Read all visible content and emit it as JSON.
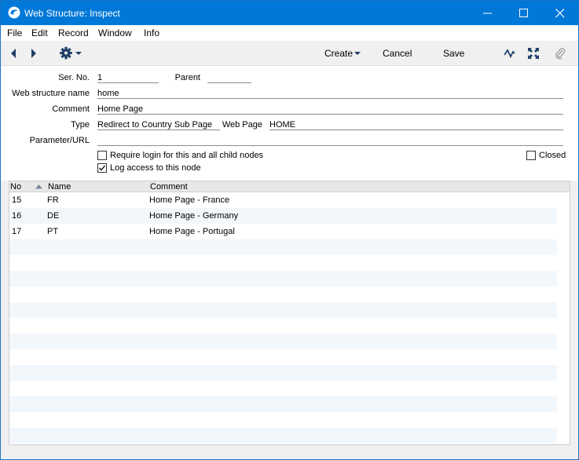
{
  "window": {
    "title": "Web Structure: Inspect"
  },
  "menu": {
    "items": [
      "File",
      "Edit",
      "Record",
      "Window",
      "Info"
    ]
  },
  "toolbar": {
    "create_label": "Create",
    "cancel_label": "Cancel",
    "save_label": "Save"
  },
  "form": {
    "ser_no_label": "Ser. No.",
    "ser_no_value": "1",
    "parent_label": "Parent",
    "parent_value": "",
    "name_label": "Web structure name",
    "name_value": "home",
    "comment_label": "Comment",
    "comment_value": "Home Page",
    "type_label": "Type",
    "type_value": "Redirect to Country Sub Page",
    "webpage_label": "Web Page",
    "webpage_value": "HOME",
    "param_label": "Parameter/URL",
    "param_value": "",
    "require_login_label": "Require login for this and all child nodes",
    "require_login_checked": false,
    "log_access_label": "Log access to this node",
    "log_access_checked": true,
    "closed_label": "Closed",
    "closed_checked": false
  },
  "grid": {
    "columns": [
      "No",
      "Name",
      "Comment"
    ],
    "rows": [
      {
        "no": "15",
        "name": "FR",
        "comment": "Home Page - France"
      },
      {
        "no": "16",
        "name": "DE",
        "comment": "Home Page - Germany"
      },
      {
        "no": "17",
        "name": "PT",
        "comment": "Home Page - Portugal"
      }
    ]
  }
}
